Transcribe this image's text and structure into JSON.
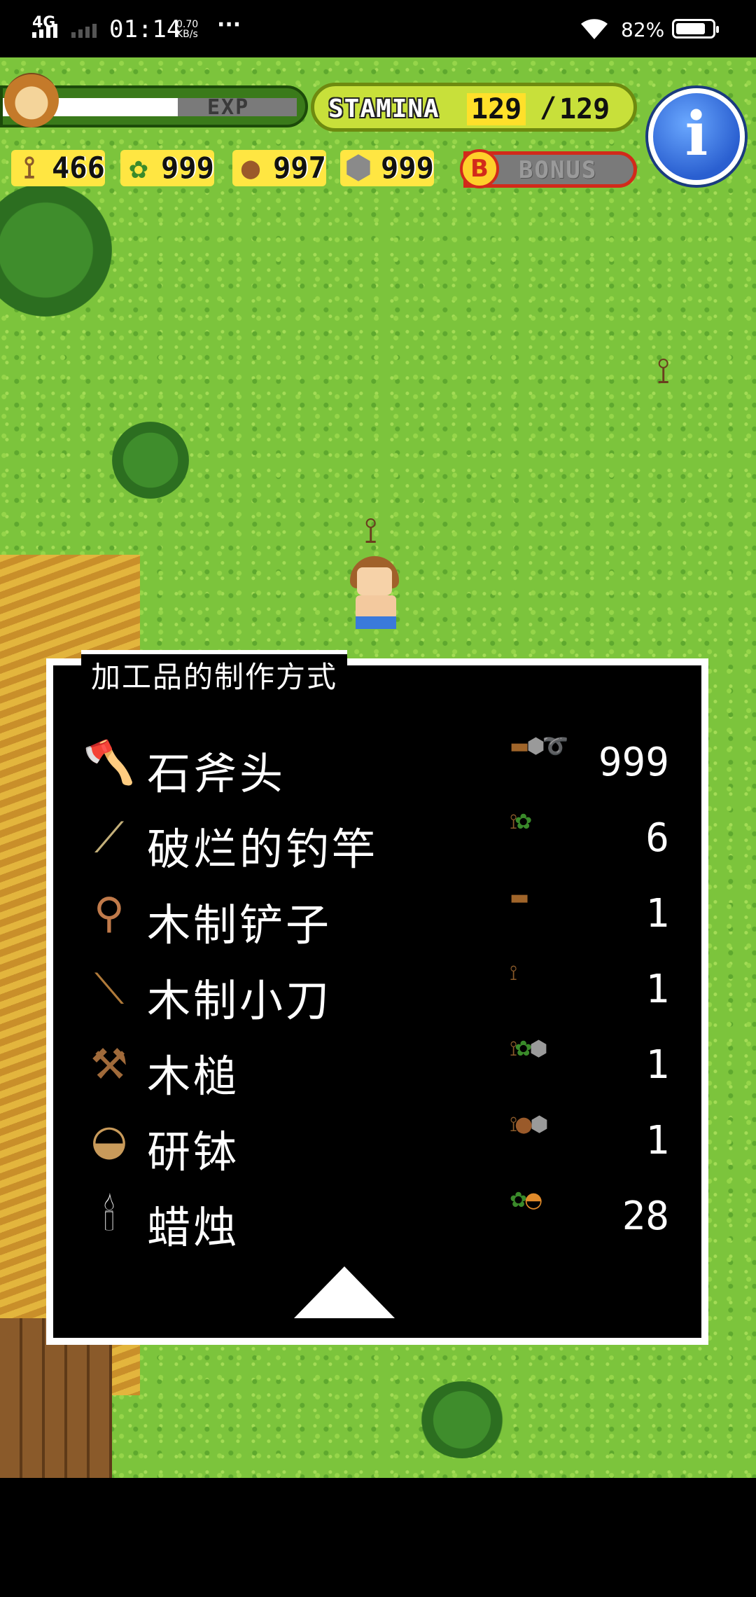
{
  "status_bar": {
    "network": "4G",
    "time": "01:14",
    "speed": "0.70\nKB/s",
    "more": "···",
    "battery": "82%",
    "battery_level": 0.82
  },
  "hud": {
    "exp_label": "EXP",
    "stamina_label": "STAMINA",
    "stamina_current": "129",
    "stamina_separator": "/",
    "stamina_max": "129",
    "info_label": "i",
    "bonus_badge": "B",
    "bonus_label": "BONUS",
    "resources": [
      {
        "icon": "branch-icon",
        "value": "466"
      },
      {
        "icon": "herb-icon",
        "value": "999"
      },
      {
        "icon": "nut-icon",
        "value": "997"
      },
      {
        "icon": "stone-icon",
        "value": "999"
      }
    ]
  },
  "panel": {
    "title": "加工品的制作方式",
    "recipes": [
      {
        "icon": "stone-axe-icon",
        "name": "石斧头",
        "materials": [
          "log-icon",
          "stone-icon",
          "rope-icon"
        ],
        "count": "999"
      },
      {
        "icon": "fishing-rod-icon",
        "name": "破烂的钓竿",
        "materials": [
          "branch-icon",
          "herb-icon"
        ],
        "count": "6"
      },
      {
        "icon": "shovel-icon",
        "name": "木制铲子",
        "materials": [
          "log-icon"
        ],
        "count": "1"
      },
      {
        "icon": "wooden-knife-icon",
        "name": "木制小刀",
        "materials": [
          "branch-icon"
        ],
        "count": "1"
      },
      {
        "icon": "mallet-icon",
        "name": "木槌",
        "materials": [
          "branch-icon",
          "herb-icon",
          "stone-icon"
        ],
        "count": "1"
      },
      {
        "icon": "mortar-icon",
        "name": "研钵",
        "materials": [
          "branch-icon",
          "nut-icon",
          "stone-icon"
        ],
        "count": "1"
      },
      {
        "icon": "candle-icon",
        "name": "蜡烛",
        "materials": [
          "herb-icon",
          "bowl-icon"
        ],
        "count": "28"
      }
    ]
  },
  "colors": {
    "grass": "#7cc43c",
    "panel_bg": "#000000",
    "panel_border": "#ffffff",
    "stamina_fill": "#c8e03a",
    "resource_bg": "#ffe642",
    "bonus_border": "#d22a1a",
    "info_button": "#2a5fd0"
  }
}
